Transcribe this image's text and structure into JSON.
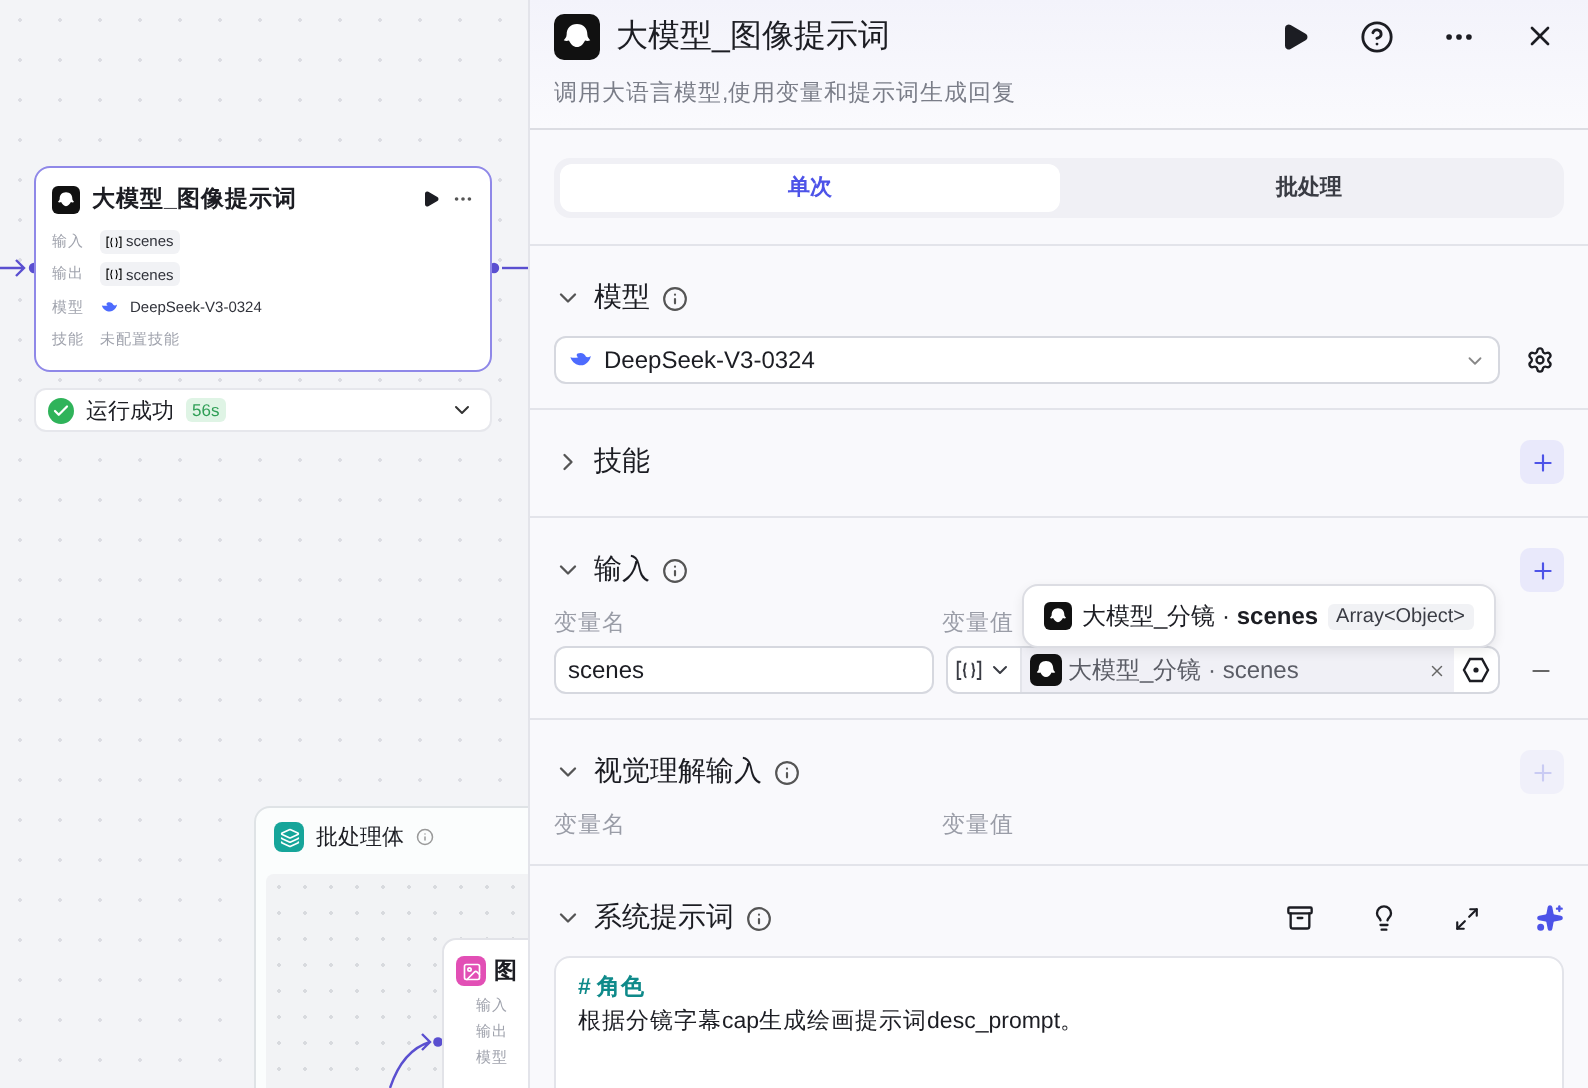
{
  "canvas": {
    "llm_node": {
      "title": "大模型_图像提示词",
      "selected": true,
      "rows": [
        {
          "label": "输入",
          "value": "scenes",
          "kind": "var"
        },
        {
          "label": "输出",
          "value": "scenes",
          "kind": "var"
        },
        {
          "label": "模型",
          "value": "DeepSeek-V3-0324",
          "kind": "model"
        },
        {
          "label": "技能",
          "value": "未配置技能",
          "kind": "muted"
        }
      ]
    },
    "run_status": {
      "label": "运行成功",
      "time": "56s"
    },
    "batch_node": {
      "title": "批处理体",
      "child": {
        "title": "图",
        "rows": [
          "输入",
          "输出",
          "模型"
        ]
      }
    }
  },
  "panel": {
    "title": "大模型_图像提示词",
    "description": "调用大语言模型,使用变量和提示词生成回复",
    "tabs": [
      {
        "label": "单次",
        "selected": true
      },
      {
        "label": "批处理",
        "selected": false
      }
    ],
    "sections": [
      {
        "kind": "model",
        "title": "模型",
        "info": true,
        "expanded": true,
        "model": "DeepSeek-V3-0324"
      },
      {
        "kind": "skills",
        "title": "技能",
        "info": false,
        "expanded": false,
        "add_disabled": false
      },
      {
        "kind": "inputs",
        "title": "输入",
        "info": true,
        "expanded": true,
        "add_disabled": false,
        "headers": [
          "变量名",
          "变量值"
        ],
        "rows": [
          {
            "name": "scenes",
            "ref": "大模型_分镜 · scenes"
          }
        ],
        "tooltip": {
          "ref": "大模型_分镜 · **scenes**",
          "type": "Array<Object>"
        }
      },
      {
        "kind": "visual",
        "title": "视觉理解输入",
        "info": true,
        "expanded": true,
        "add_disabled": true,
        "headers": [
          "变量名",
          "变量值"
        ]
      },
      {
        "kind": "prompt",
        "title": "系统提示词",
        "info": true,
        "expanded": true,
        "heading": "# 角色",
        "text": "根据分镜字幕cap生成绘画提示词desc_prompt。"
      }
    ]
  }
}
